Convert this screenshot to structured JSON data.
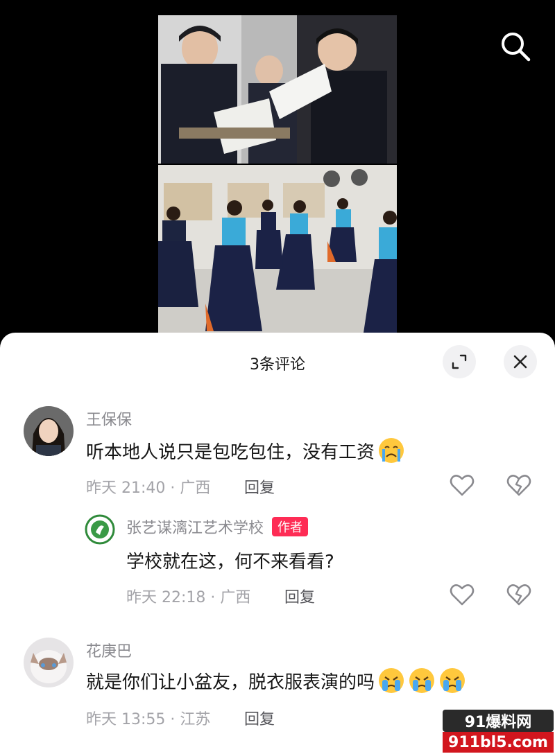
{
  "sheet": {
    "title": "3条评论"
  },
  "icons": {
    "search": "search-icon",
    "expand": "expand-icon",
    "close": "close-icon",
    "like": "heart-icon",
    "dislike": "broken-heart-icon"
  },
  "colors": {
    "accent": "#fe2c55",
    "author_badge": "#fe2c55"
  },
  "comments": [
    {
      "username": "王保保",
      "text": "听本地人说只是包吃包住，没有工资",
      "emoji": "crying-face",
      "meta": "昨天 21:40 · 广西",
      "reply_label": "回复",
      "replies": [
        {
          "username": "张艺谋漓江艺术学校",
          "author_badge": "作者",
          "text": "学校就在这，何不来看看?",
          "meta": "昨天 22:18 · 广西",
          "reply_label": "回复"
        }
      ]
    },
    {
      "username": "花庚巴",
      "text": "就是你们让小盆友，脱衣服表演的吗",
      "emoji": "crying-face x3",
      "meta": "昨天 13:55 · 江苏",
      "reply_label": "回复"
    }
  ],
  "watermark": {
    "top": "91爆料网",
    "bottom": "911bl5.com"
  }
}
